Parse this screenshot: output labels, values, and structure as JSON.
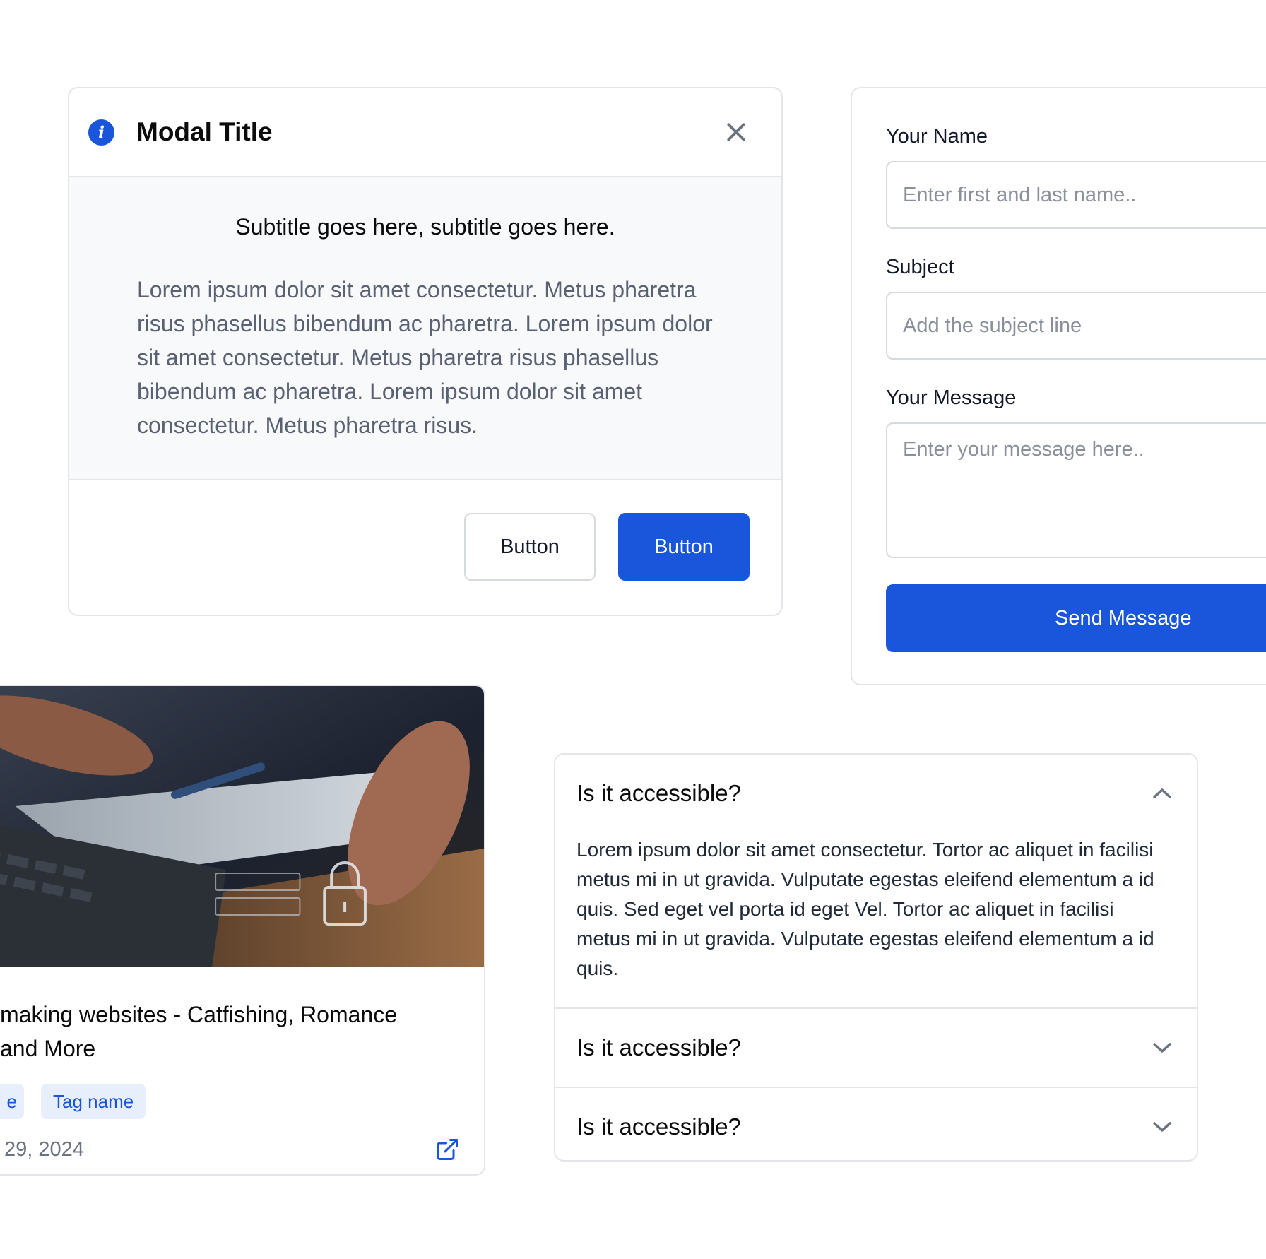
{
  "modal": {
    "title": "Modal Title",
    "subtitle": "Subtitle goes here, subtitle goes here.",
    "body": "Lorem ipsum dolor sit amet consectetur. Metus pharetra risus phasellus bibendum ac pharetra. Lorem ipsum dolor sit amet consectetur. Metus pharetra risus phasellus bibendum ac pharetra. Lorem ipsum dolor sit amet consectetur. Metus pharetra risus.",
    "secondary_button": "Button",
    "primary_button": "Button"
  },
  "form": {
    "name_label": "Your Name",
    "name_placeholder": "Enter first and last name..",
    "subject_label": "Subject",
    "subject_placeholder": "Add the subject line",
    "message_label": "Your Message",
    "message_placeholder": "Enter your message here..",
    "send_label": "Send Message"
  },
  "blog": {
    "title": "making websites - Catfishing, Romance and More",
    "tags": [
      "e",
      "Tag name"
    ],
    "date": "29, 2024"
  },
  "accordion": {
    "items": [
      {
        "question": "Is it accessible?",
        "answer": "Lorem ipsum dolor sit amet consectetur. Tortor ac aliquet in facilisi metus mi in ut gravida. Vulputate egestas eleifend elementum a id quis. Sed eget vel porta id eget Vel. Tortor ac aliquet in facilisi metus mi in ut gravida. Vulputate egestas eleifend elementum a id quis.",
        "expanded": true
      },
      {
        "question": "Is it accessible?",
        "expanded": false
      },
      {
        "question": "Is it accessible?",
        "expanded": false
      }
    ]
  },
  "colors": {
    "primary": "#1a56db",
    "tag_bg": "#e7effd",
    "border": "#e3e5e9",
    "modal_body_bg": "#f8f9fb"
  },
  "icons": [
    "info-icon",
    "close-icon",
    "external-link-icon",
    "chevron-up-icon",
    "chevron-down-icon",
    "padlock-icon"
  ]
}
